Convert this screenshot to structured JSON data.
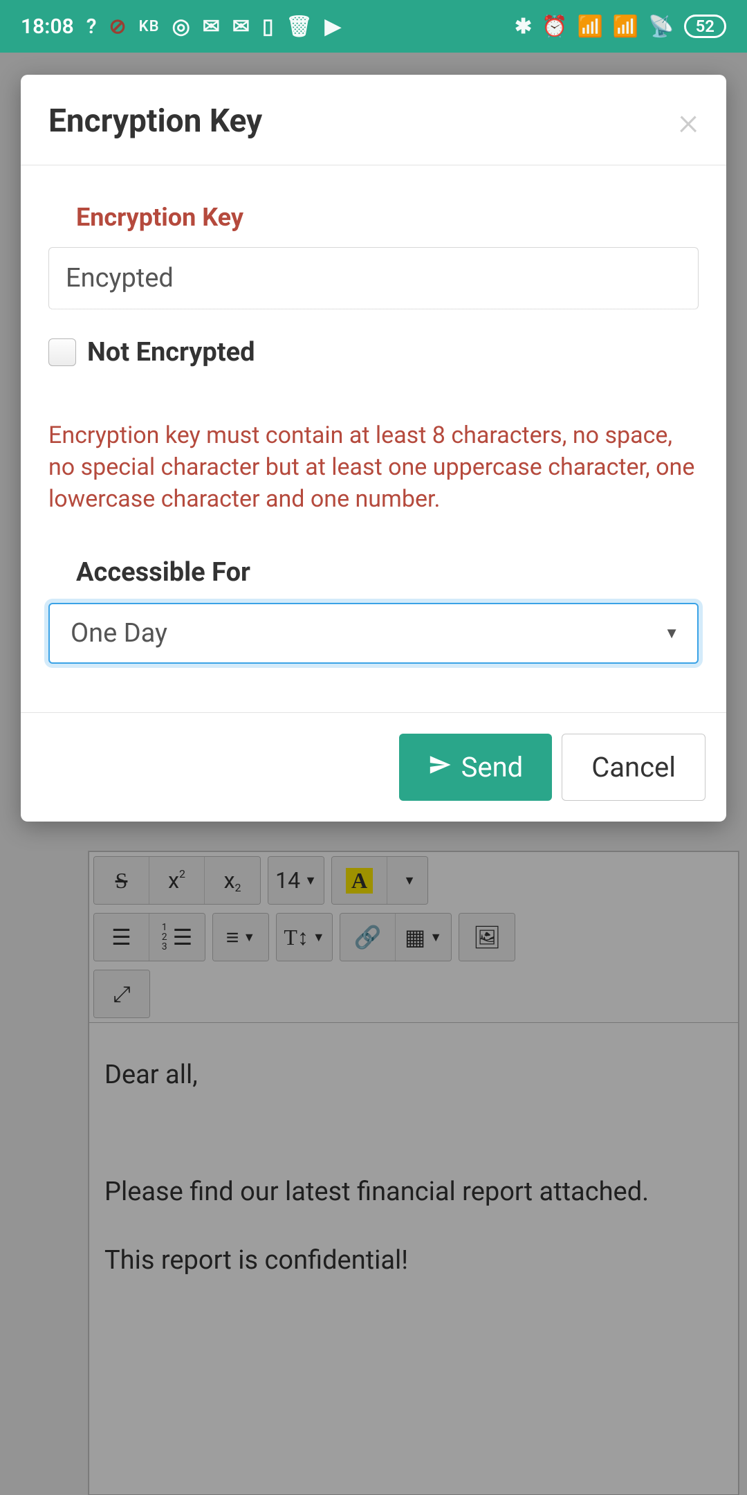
{
  "status": {
    "time": "18:08",
    "kb": "KB",
    "battery": "52"
  },
  "modal": {
    "title": "Encryption Key",
    "enc_label": "Encryption Key",
    "enc_value": "Encypted",
    "not_encrypted_label": "Not Encrypted",
    "help": "Encryption key must contain at least 8 characters, no space, no special character but at least one uppercase character, one lowercase character and one number.",
    "accessible_label": "Accessible For",
    "accessible_value": "One Day",
    "send_label": "Send",
    "cancel_label": "Cancel"
  },
  "editor": {
    "font_size": "14",
    "line1": "Dear all,",
    "line2": "Please find our latest financial report attached.",
    "line3": "This report is confidential!"
  }
}
